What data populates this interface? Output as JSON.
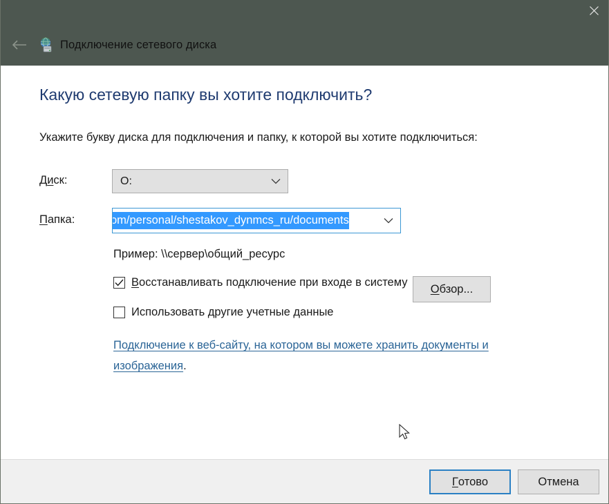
{
  "window": {
    "title": "Подключение сетевого диска",
    "titlebar_color": "#4d5750",
    "icon": "network-drive-icon",
    "back_icon": "back-arrow-icon",
    "close_icon": "close-icon"
  },
  "content": {
    "heading": "Какую сетевую папку вы хотите подключить?",
    "heading_color": "#1f3b70",
    "subtitle": "Укажите букву диска для подключения и папку, к которой вы хотите подключиться:",
    "drive": {
      "label_before": "Д",
      "label_accel": "и",
      "label_after": "ск:",
      "value": "O:",
      "arrow_icon": "chevron-down-icon"
    },
    "folder": {
      "label_accel": "П",
      "label_after": "апка:",
      "value": "om/personal/shestakov_dynmcs_ru/documents",
      "selected": true,
      "arrow_icon": "chevron-down-icon"
    },
    "browse_button": {
      "label_accel": "О",
      "label_after": "бзор..."
    },
    "example": "Пример: \\\\сервер\\общий_ресурс",
    "checkboxes": [
      {
        "label_before": "",
        "label_accel": "В",
        "label_after": "осстанавливать подключение при входе в систему",
        "checked": true,
        "check_glyph": "checkmark-icon"
      },
      {
        "label_before": "Использовать другие учетные ",
        "label_accel": "д",
        "label_after": "анные",
        "checked": false,
        "check_glyph": "checkmark-icon"
      }
    ],
    "link": {
      "text": "Подключение к веб-сайту, на котором вы можете хранить документы и изображения",
      "trailing": ".",
      "color": "#2a6496"
    }
  },
  "footer": {
    "ok_accel": "Г",
    "ok_after": "отово",
    "cancel_label": "Отмена",
    "accent_color": "#2a80c4"
  }
}
